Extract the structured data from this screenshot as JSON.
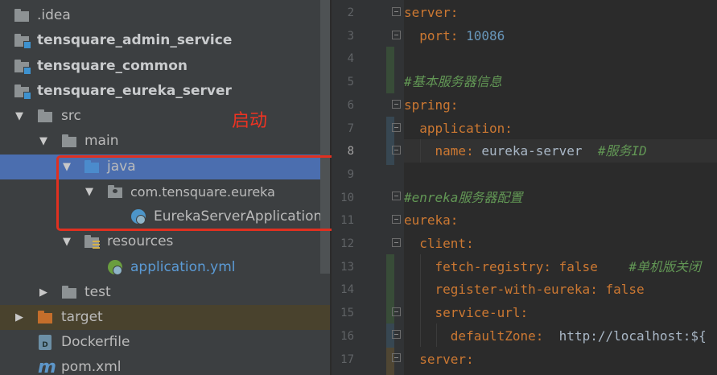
{
  "project_tree": {
    "items": [
      {
        "label": ".idea",
        "icon": "folder-icon",
        "expanded": null
      },
      {
        "label": "tensquare_admin_service",
        "icon": "module-folder-icon",
        "expanded": false
      },
      {
        "label": "tensquare_common",
        "icon": "module-folder-icon",
        "expanded": false
      },
      {
        "label": "tensquare_eureka_server",
        "icon": "module-folder-icon",
        "expanded": true
      },
      {
        "label": "src",
        "icon": "folder-icon",
        "expanded": true
      },
      {
        "label": "main",
        "icon": "folder-icon",
        "expanded": true
      },
      {
        "label": "java",
        "icon": "source-folder-icon",
        "expanded": true,
        "selected": true
      },
      {
        "label": "com.tensquare.eureka",
        "icon": "package-icon",
        "expanded": true
      },
      {
        "label": "EurekaServerApplication",
        "icon": "spring-boot-class-icon",
        "expanded": null
      },
      {
        "label": "resources",
        "icon": "resources-folder-icon",
        "expanded": true
      },
      {
        "label": "application.yml",
        "icon": "spring-yml-icon",
        "expanded": null
      },
      {
        "label": "test",
        "icon": "folder-icon",
        "expanded": false
      },
      {
        "label": "target",
        "icon": "excluded-folder-icon",
        "expanded": false
      },
      {
        "label": "Dockerfile",
        "icon": "docker-file-icon",
        "expanded": null
      },
      {
        "label": "pom.xml",
        "icon": "maven-pom-icon",
        "expanded": null
      }
    ]
  },
  "annotation": {
    "text": "启动",
    "color": "#ef3322"
  },
  "editor": {
    "current_line": 8,
    "lines": [
      {
        "num": "2",
        "tokens": [
          {
            "t": "server",
            "c": "k"
          },
          {
            "t": ":",
            "c": "p"
          }
        ]
      },
      {
        "num": "3",
        "tokens": [
          {
            "t": "  port",
            "c": "k"
          },
          {
            "t": ": ",
            "c": "p"
          },
          {
            "t": "10086",
            "c": "v"
          }
        ]
      },
      {
        "num": "4",
        "tokens": []
      },
      {
        "num": "5",
        "tokens": [
          {
            "t": "#基本服务器信息",
            "c": "c"
          }
        ]
      },
      {
        "num": "6",
        "tokens": [
          {
            "t": "spring",
            "c": "k"
          },
          {
            "t": ":",
            "c": "p"
          }
        ]
      },
      {
        "num": "7",
        "tokens": [
          {
            "t": "  application",
            "c": "k"
          },
          {
            "t": ":",
            "c": "p"
          }
        ]
      },
      {
        "num": "8",
        "tokens": [
          {
            "t": "    name",
            "c": "k"
          },
          {
            "t": ": ",
            "c": "p"
          },
          {
            "t": "eureka-server  ",
            "c": "s"
          },
          {
            "t": "#服务ID",
            "c": "c"
          }
        ]
      },
      {
        "num": "9",
        "tokens": []
      },
      {
        "num": "10",
        "tokens": [
          {
            "t": "#enreka服务器配置",
            "c": "c"
          }
        ]
      },
      {
        "num": "11",
        "tokens": [
          {
            "t": "eureka",
            "c": "k"
          },
          {
            "t": ":",
            "c": "p"
          }
        ]
      },
      {
        "num": "12",
        "tokens": [
          {
            "t": "  client",
            "c": "k"
          },
          {
            "t": ":",
            "c": "p"
          }
        ]
      },
      {
        "num": "13",
        "tokens": [
          {
            "t": "    fetch-registry",
            "c": "k"
          },
          {
            "t": ": ",
            "c": "p"
          },
          {
            "t": "false",
            "c": "k"
          },
          {
            "t": "    #单机版关闭",
            "c": "c"
          }
        ]
      },
      {
        "num": "14",
        "tokens": [
          {
            "t": "    register-with-eureka",
            "c": "k"
          },
          {
            "t": ": ",
            "c": "p"
          },
          {
            "t": "false",
            "c": "k"
          }
        ]
      },
      {
        "num": "15",
        "tokens": [
          {
            "t": "    service-url",
            "c": "k"
          },
          {
            "t": ":",
            "c": "p"
          }
        ]
      },
      {
        "num": "16",
        "tokens": [
          {
            "t": "      defaultZone",
            "c": "k"
          },
          {
            "t": ":  ",
            "c": "p"
          },
          {
            "t": "http://localhost:${",
            "c": "s"
          }
        ]
      },
      {
        "num": "17",
        "tokens": [
          {
            "t": "  server",
            "c": "k"
          },
          {
            "t": ":",
            "c": "p"
          }
        ]
      }
    ]
  },
  "colors": {
    "tree_bg": "#3c3f41",
    "selection": "#4b6eaf",
    "editor_bg": "#2b2b2b",
    "yaml_key": "#cc7832",
    "number": "#6897bb",
    "comment": "#629755"
  }
}
